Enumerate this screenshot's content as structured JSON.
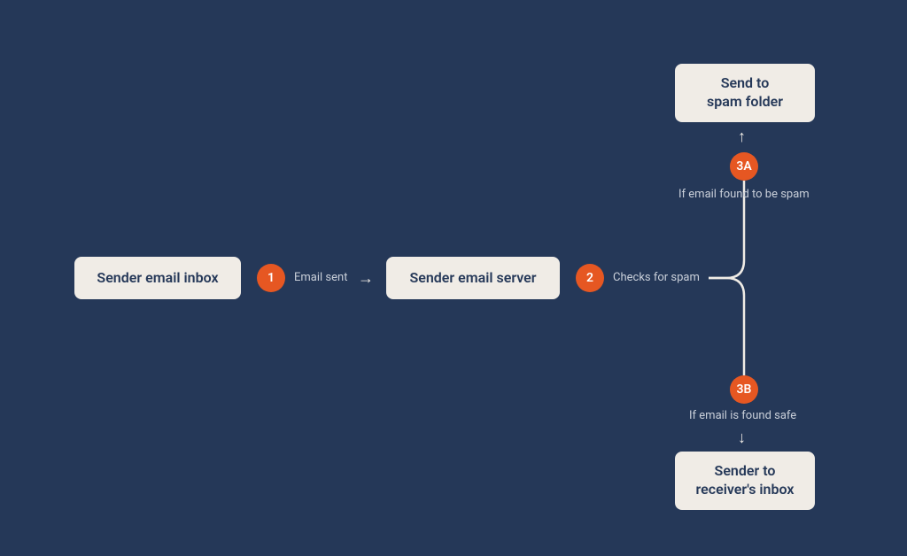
{
  "nodes": {
    "sender_inbox": "Sender email inbox",
    "sender_server": "Sender email server",
    "spam_folder": "Send to\nspam folder",
    "receiver_inbox": "Sender to\nreceiver's inbox"
  },
  "steps": {
    "s1": {
      "badge": "1",
      "caption": "Email sent"
    },
    "s2": {
      "badge": "2",
      "caption": "Checks for spam"
    },
    "s3a": {
      "badge": "3A",
      "caption": "If email found to be spam"
    },
    "s3b": {
      "badge": "3B",
      "caption": "If email is found safe"
    }
  },
  "colors": {
    "bg": "#253858",
    "card": "#f0ece6",
    "accent": "#e65722",
    "text_light": "#c9cfd9"
  }
}
